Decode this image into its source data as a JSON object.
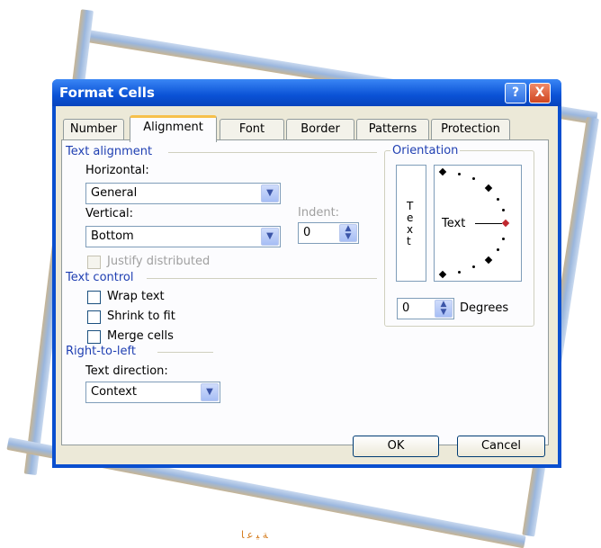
{
  "dialog": {
    "title": "Format Cells",
    "help_glyph": "?",
    "close_glyph": "X"
  },
  "tabs": [
    {
      "label": "Number"
    },
    {
      "label": "Alignment"
    },
    {
      "label": "Font"
    },
    {
      "label": "Border"
    },
    {
      "label": "Patterns"
    },
    {
      "label": "Protection"
    }
  ],
  "text_alignment": {
    "group_label": "Text alignment",
    "horizontal_label": "Horizontal:",
    "horizontal_value": "General",
    "vertical_label": "Vertical:",
    "vertical_value": "Bottom",
    "indent_label": "Indent:",
    "indent_value": "0",
    "justify_label": "Justify distributed"
  },
  "text_control": {
    "group_label": "Text control",
    "wrap_label": "Wrap text",
    "shrink_label": "Shrink to fit",
    "merge_label": "Merge cells"
  },
  "rtl": {
    "group_label": "Right-to-left",
    "direction_label": "Text direction:",
    "direction_value": "Context"
  },
  "orientation": {
    "group_label": "Orientation",
    "vertical_letters": [
      "T",
      "e",
      "x",
      "t"
    ],
    "dial_label": "Text",
    "degrees_value": "0",
    "degrees_label": "Degrees"
  },
  "buttons": {
    "ok": "OK",
    "cancel": "Cancel"
  },
  "footer_text": "ﺔ ﻴ ﻋ ﺎ",
  "colors": {
    "frame_bar_light": "#9fc0e6",
    "frame_bar_tan": "#c9b89a",
    "title_blue": "#0a52d6",
    "group_text": "#1f3fb2",
    "dial_marker": "#c0282f"
  }
}
